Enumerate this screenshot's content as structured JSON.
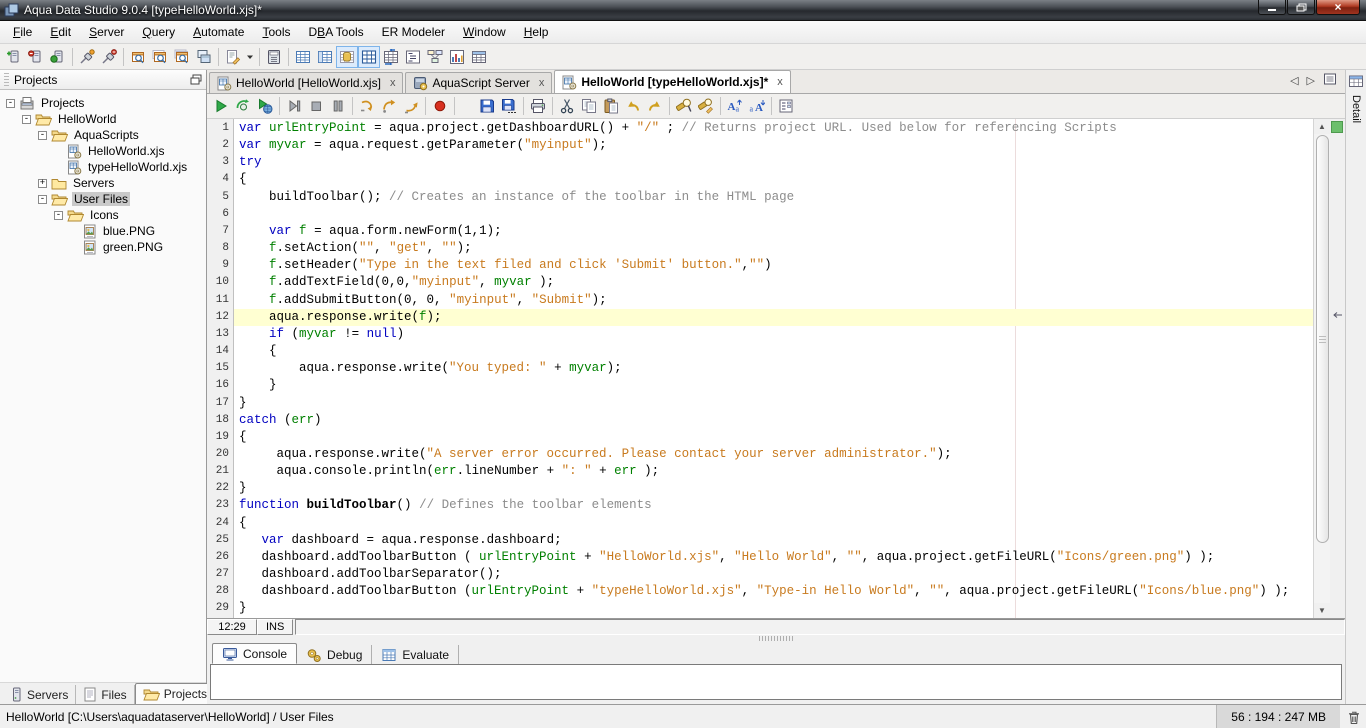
{
  "window": {
    "title": "Aqua Data Studio 9.0.4 [typeHelloWorld.xjs]*"
  },
  "menu": {
    "items": [
      {
        "label": "File",
        "mn": 0
      },
      {
        "label": "Edit",
        "mn": 0
      },
      {
        "label": "Server",
        "mn": 0
      },
      {
        "label": "Query",
        "mn": 0
      },
      {
        "label": "Automate",
        "mn": 0
      },
      {
        "label": "Tools",
        "mn": 0
      },
      {
        "label": "DBA Tools",
        "mn": 1
      },
      {
        "label": "ER Modeler",
        "mn": -1
      },
      {
        "label": "Window",
        "mn": 0
      },
      {
        "label": "Help",
        "mn": 0
      }
    ]
  },
  "main_toolbar": {
    "buttons": [
      {
        "icon": "register-server"
      },
      {
        "icon": "unregister-server"
      },
      {
        "icon": "connect-server"
      },
      {
        "sep": true
      },
      {
        "icon": "plug-add"
      },
      {
        "icon": "plug-remove"
      },
      {
        "sep": true
      },
      {
        "icon": "query-window"
      },
      {
        "icon": "query-window2"
      },
      {
        "icon": "query-window3"
      },
      {
        "icon": "windows-cascade"
      },
      {
        "sep": true
      },
      {
        "icon": "script-open"
      },
      {
        "icon": "caret-down",
        "narrow": true
      },
      {
        "sep": true
      },
      {
        "icon": "schema-browser"
      },
      {
        "sep": true
      },
      {
        "icon": "table-results"
      },
      {
        "icon": "table-side"
      },
      {
        "icon": "db-cylinder",
        "active": true
      },
      {
        "icon": "grid-large",
        "active": true
      },
      {
        "icon": "table-swap"
      },
      {
        "icon": "outline-view"
      },
      {
        "icon": "er-diagram"
      },
      {
        "icon": "bar-chart"
      },
      {
        "icon": "table-header-blue"
      }
    ]
  },
  "editor_toolbar": {
    "buttons": [
      {
        "icon": "execute"
      },
      {
        "icon": "execute-edit"
      },
      {
        "icon": "execute-server"
      },
      {
        "sep": true
      },
      {
        "icon": "step"
      },
      {
        "icon": "stop"
      },
      {
        "icon": "pause"
      },
      {
        "sep": true
      },
      {
        "icon": "step-into"
      },
      {
        "icon": "step-over"
      },
      {
        "icon": "step-out"
      },
      {
        "sep": true
      },
      {
        "icon": "breakpoint"
      },
      {
        "sep": true
      },
      {
        "space": true
      },
      {
        "icon": "save"
      },
      {
        "icon": "save-as"
      },
      {
        "sep": true
      },
      {
        "icon": "print"
      },
      {
        "sep": true
      },
      {
        "icon": "cut"
      },
      {
        "icon": "copy"
      },
      {
        "icon": "paste"
      },
      {
        "icon": "undo"
      },
      {
        "icon": "redo"
      },
      {
        "sep": true
      },
      {
        "icon": "find"
      },
      {
        "icon": "find-replace"
      },
      {
        "sep": true
      },
      {
        "icon": "case-upper"
      },
      {
        "icon": "case-lower"
      },
      {
        "sep": true
      },
      {
        "icon": "editor-options"
      }
    ]
  },
  "sidebar": {
    "header": {
      "title": "Projects"
    },
    "tree": [
      {
        "label": "Projects",
        "icon": "projects-root",
        "toggle": "-",
        "depth": 0
      },
      {
        "label": "HelloWorld",
        "icon": "folder-open",
        "toggle": "-",
        "depth": 1
      },
      {
        "label": "AquaScripts",
        "icon": "folder-open",
        "toggle": "-",
        "depth": 2
      },
      {
        "label": "HelloWorld.xjs",
        "icon": "script-file",
        "toggle": null,
        "depth": 3
      },
      {
        "label": "typeHelloWorld.xjs",
        "icon": "script-file",
        "toggle": null,
        "depth": 3
      },
      {
        "label": "Servers",
        "icon": "folder-closed",
        "toggle": "+",
        "depth": 2
      },
      {
        "label": "User Files",
        "icon": "folder-open",
        "toggle": "-",
        "depth": 2,
        "selected": true
      },
      {
        "label": "Icons",
        "icon": "folder-open",
        "toggle": "-",
        "depth": 3
      },
      {
        "label": "blue.PNG",
        "icon": "image-file",
        "toggle": null,
        "depth": 4
      },
      {
        "label": "green.PNG",
        "icon": "image-file",
        "toggle": null,
        "depth": 4
      }
    ],
    "tabs": [
      {
        "label": "Servers",
        "icon": "servers-tab"
      },
      {
        "label": "Files",
        "icon": "files-tab"
      },
      {
        "label": "Projects",
        "icon": "projects-tab",
        "active": true
      }
    ]
  },
  "editor": {
    "tabs": [
      {
        "label": "HelloWorld [HelloWorld.xjs]",
        "icon": "script-tab"
      },
      {
        "label": "AquaScript Server",
        "icon": "server-tab"
      },
      {
        "label": "HelloWorld [typeHelloWorld.xjs]*",
        "icon": "script-tab",
        "active": true
      }
    ],
    "close_glyph": "x",
    "status": {
      "position": "12:29",
      "mode": "INS"
    },
    "lines": [
      {
        "n": 1,
        "segs": [
          [
            "kw",
            "var"
          ],
          [
            "pl",
            " "
          ],
          [
            "vr",
            "urlEntryPoint"
          ],
          [
            "pl",
            " = aqua.project.getDashboardURL() + "
          ],
          [
            "st",
            "\"/\""
          ],
          [
            "pl",
            " ; "
          ],
          [
            "cm",
            "// Returns project URL. Used below for referencing Scripts"
          ]
        ]
      },
      {
        "n": 2,
        "segs": [
          [
            "kw",
            "var"
          ],
          [
            "pl",
            " "
          ],
          [
            "vr",
            "myvar"
          ],
          [
            "pl",
            " = aqua.request.getParameter("
          ],
          [
            "st",
            "\"myinput\""
          ],
          [
            "pl",
            ");"
          ]
        ]
      },
      {
        "n": 3,
        "segs": [
          [
            "kw",
            "try"
          ]
        ]
      },
      {
        "n": 4,
        "segs": [
          [
            "pl",
            "{"
          ]
        ]
      },
      {
        "n": 5,
        "segs": [
          [
            "pl",
            "    buildToolbar(); "
          ],
          [
            "cm",
            "// Creates an instance of the toolbar in the HTML page"
          ]
        ]
      },
      {
        "n": 6,
        "segs": []
      },
      {
        "n": 7,
        "segs": [
          [
            "pl",
            "    "
          ],
          [
            "kw",
            "var"
          ],
          [
            "pl",
            " "
          ],
          [
            "vr",
            "f"
          ],
          [
            "pl",
            " = aqua.form.newForm(1,1);"
          ]
        ]
      },
      {
        "n": 8,
        "segs": [
          [
            "pl",
            "    "
          ],
          [
            "vr",
            "f"
          ],
          [
            "pl",
            ".setAction("
          ],
          [
            "st",
            "\"\""
          ],
          [
            "pl",
            ", "
          ],
          [
            "st",
            "\"get\""
          ],
          [
            "pl",
            ", "
          ],
          [
            "st",
            "\"\""
          ],
          [
            "pl",
            ");"
          ]
        ]
      },
      {
        "n": 9,
        "segs": [
          [
            "pl",
            "    "
          ],
          [
            "vr",
            "f"
          ],
          [
            "pl",
            ".setHeader("
          ],
          [
            "st",
            "\"Type in the text filed and click 'Submit' button.\""
          ],
          [
            "pl",
            ","
          ],
          [
            "st",
            "\"\""
          ],
          [
            "pl",
            ")"
          ]
        ]
      },
      {
        "n": 10,
        "segs": [
          [
            "pl",
            "    "
          ],
          [
            "vr",
            "f"
          ],
          [
            "pl",
            ".addTextField(0,0,"
          ],
          [
            "st",
            "\"myinput\""
          ],
          [
            "pl",
            ", "
          ],
          [
            "vr",
            "myvar"
          ],
          [
            "pl",
            " );"
          ]
        ]
      },
      {
        "n": 11,
        "segs": [
          [
            "pl",
            "    "
          ],
          [
            "vr",
            "f"
          ],
          [
            "pl",
            ".addSubmitButton(0, 0, "
          ],
          [
            "st",
            "\"myinput\""
          ],
          [
            "pl",
            ", "
          ],
          [
            "st",
            "\"Submit\""
          ],
          [
            "pl",
            ");"
          ]
        ]
      },
      {
        "n": 12,
        "hl": true,
        "segs": [
          [
            "pl",
            "    aqua.response.write("
          ],
          [
            "vr",
            "f"
          ],
          [
            "pl",
            ");"
          ]
        ]
      },
      {
        "n": 13,
        "segs": [
          [
            "pl",
            "    "
          ],
          [
            "kw",
            "if"
          ],
          [
            "pl",
            " ("
          ],
          [
            "vr",
            "myvar"
          ],
          [
            "pl",
            " != "
          ],
          [
            "kw",
            "null"
          ],
          [
            "pl",
            ")"
          ]
        ]
      },
      {
        "n": 14,
        "segs": [
          [
            "pl",
            "    {"
          ]
        ]
      },
      {
        "n": 15,
        "segs": [
          [
            "pl",
            "        aqua.response.write("
          ],
          [
            "st",
            "\"You typed: \""
          ],
          [
            "pl",
            " + "
          ],
          [
            "vr",
            "myvar"
          ],
          [
            "pl",
            ");"
          ]
        ]
      },
      {
        "n": 16,
        "segs": [
          [
            "pl",
            "    }"
          ]
        ]
      },
      {
        "n": 17,
        "segs": [
          [
            "pl",
            "}"
          ]
        ]
      },
      {
        "n": 18,
        "segs": [
          [
            "kw",
            "catch"
          ],
          [
            "pl",
            " ("
          ],
          [
            "vr",
            "err"
          ],
          [
            "pl",
            ")"
          ]
        ]
      },
      {
        "n": 19,
        "segs": [
          [
            "pl",
            "{"
          ]
        ]
      },
      {
        "n": 20,
        "segs": [
          [
            "pl",
            "     aqua.response.write("
          ],
          [
            "st",
            "\"A server error occurred. Please contact your server administrator.\""
          ],
          [
            "pl",
            ");"
          ]
        ]
      },
      {
        "n": 21,
        "segs": [
          [
            "pl",
            "     aqua.console.println("
          ],
          [
            "vr",
            "err"
          ],
          [
            "pl",
            ".lineNumber + "
          ],
          [
            "st",
            "\": \""
          ],
          [
            "pl",
            " + "
          ],
          [
            "vr",
            "err"
          ],
          [
            "pl",
            " );"
          ]
        ]
      },
      {
        "n": 22,
        "segs": [
          [
            "pl",
            "}"
          ]
        ]
      },
      {
        "n": 23,
        "segs": [
          [
            "kw",
            "function"
          ],
          [
            "pl",
            " "
          ],
          [
            "fn",
            "buildToolbar"
          ],
          [
            "pl",
            "() "
          ],
          [
            "cm",
            "// Defines the toolbar elements"
          ]
        ]
      },
      {
        "n": 24,
        "segs": [
          [
            "pl",
            "{"
          ]
        ]
      },
      {
        "n": 25,
        "segs": [
          [
            "pl",
            "   "
          ],
          [
            "kw",
            "var"
          ],
          [
            "pl",
            " dashboard = aqua.response.dashboard;"
          ]
        ]
      },
      {
        "n": 26,
        "segs": [
          [
            "pl",
            "   dashboard.addToolbarButton ( "
          ],
          [
            "vr",
            "urlEntryPoint"
          ],
          [
            "pl",
            " + "
          ],
          [
            "st",
            "\"HelloWorld.xjs\""
          ],
          [
            "pl",
            ", "
          ],
          [
            "st",
            "\"Hello World\""
          ],
          [
            "pl",
            ", "
          ],
          [
            "st",
            "\"\""
          ],
          [
            "pl",
            ", aqua.project.getFileURL("
          ],
          [
            "st",
            "\"Icons/green.png\""
          ],
          [
            "pl",
            ") );"
          ]
        ]
      },
      {
        "n": 27,
        "segs": [
          [
            "pl",
            "   dashboard.addToolbarSeparator();"
          ]
        ]
      },
      {
        "n": 28,
        "segs": [
          [
            "pl",
            "   dashboard.addToolbarButton ("
          ],
          [
            "vr",
            "urlEntryPoint"
          ],
          [
            "pl",
            " + "
          ],
          [
            "st",
            "\"typeHelloWorld.xjs\""
          ],
          [
            "pl",
            ", "
          ],
          [
            "st",
            "\"Type-in Hello World\""
          ],
          [
            "pl",
            ", "
          ],
          [
            "st",
            "\"\""
          ],
          [
            "pl",
            ", aqua.project.getFileURL("
          ],
          [
            "st",
            "\"Icons/blue.png\""
          ],
          [
            "pl",
            ") );"
          ]
        ]
      },
      {
        "n": 29,
        "segs": [
          [
            "pl",
            "}"
          ]
        ]
      }
    ]
  },
  "console": {
    "tabs": [
      {
        "label": "Console",
        "icon": "console",
        "active": true
      },
      {
        "label": "Debug",
        "icon": "debug"
      },
      {
        "label": "Evaluate",
        "icon": "evaluate"
      }
    ]
  },
  "detail_panel": {
    "label": "Detail"
  },
  "statusbar": {
    "left": "HelloWorld [C:\\Users\\aquadataserver\\HelloWorld] / User Files",
    "memory": "56 : 194 : 247 MB"
  },
  "colors": {
    "keyword": "#0000c0",
    "variable": "#008000",
    "string": "#c87a1e",
    "comment": "#8c8c8c",
    "line_highlight": "#ffffd2",
    "selection_inactive": "#c9c9c9",
    "toolbar_active_border": "#7eb4ea"
  }
}
